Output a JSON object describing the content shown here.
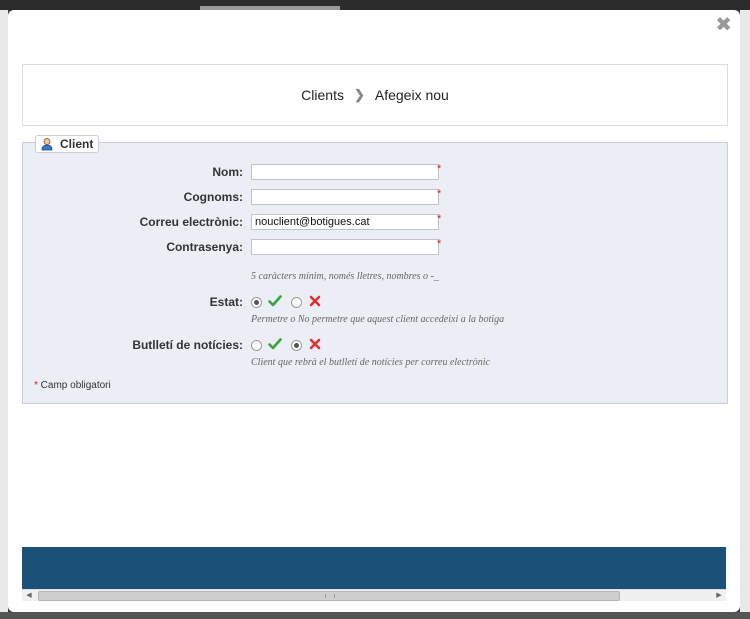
{
  "modal": {
    "close_label": "✖"
  },
  "breadcrumb": {
    "section": "Clients",
    "separator": "❯",
    "current": "Afegeix nou"
  },
  "form": {
    "legend": "Client",
    "fields": {
      "first_name": {
        "label": "Nom:",
        "value": "",
        "required": "*"
      },
      "last_name": {
        "label": "Cognoms:",
        "value": "",
        "required": "*"
      },
      "email": {
        "label": "Correu electrònic:",
        "value": "nouclient@botigues.cat",
        "required": "*"
      },
      "password": {
        "label": "Contrasenya:",
        "value": "",
        "required": "*",
        "hint": "5 caràcters mínim, només lletres, nombres o -_"
      }
    },
    "status": {
      "label": "Estat:",
      "selected": "yes",
      "hint": "Permetre o No permetre que aquest client accedeixi a la botiga"
    },
    "newsletter": {
      "label": "Butlletí de notícies:",
      "selected": "no",
      "hint": "Client que rebrà el butlletí de notícies per correu electrònic"
    },
    "footnote_star": "*",
    "footnote_text": " Camp obligatori"
  },
  "colors": {
    "accent_footer": "#1b5178",
    "required": "#e02020",
    "check": "#3aa23a",
    "cross": "#e03030"
  }
}
